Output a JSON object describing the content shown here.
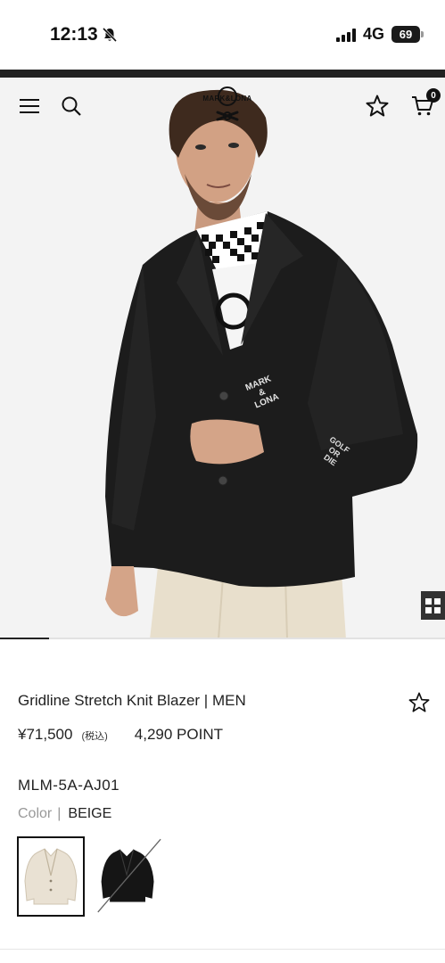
{
  "status_bar": {
    "time": "12:13",
    "network": "4G",
    "battery": "69",
    "icons": [
      "bell-slash-icon",
      "signal-icon",
      "battery-icon"
    ]
  },
  "header": {
    "logo_text": "MARK&LONA",
    "cart_count": "0",
    "icons": [
      "menu-icon",
      "search-icon",
      "star-icon",
      "cart-icon"
    ]
  },
  "hero": {
    "jacket_print": [
      "MARK",
      "&",
      "LONA"
    ],
    "sleeve_print": [
      "GOLF",
      "OR",
      "DIE"
    ],
    "carousel_progress": 0.11,
    "grid_toggle_icon": "grid-icon"
  },
  "product": {
    "name": "Gridline Stretch Knit Blazer | MEN",
    "price": "¥71,500",
    "tax_note": "(税込)",
    "points": "4,290 POINT",
    "sku": "MLM-5A-AJ01",
    "color_label": "Color",
    "color_separator": "|",
    "color_value": "BEIGE",
    "swatches": [
      {
        "color": "#e9e1d3",
        "selected": true,
        "available": true
      },
      {
        "color": "#151515",
        "selected": false,
        "available": false
      }
    ]
  },
  "colors": {
    "jacket": "#1c1c1c",
    "pants": "#e8dfcc",
    "accent": "#111111"
  }
}
